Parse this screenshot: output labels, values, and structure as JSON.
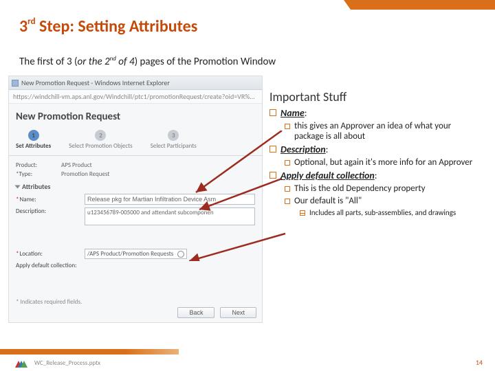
{
  "title": {
    "ord": "3",
    "ord_suffix": "rd",
    "rest": " Step:   Setting Attributes"
  },
  "subtitle": {
    "pre": "The first of 3 (",
    "italic_pre": "or the 2",
    "sup": "nd",
    "italic_post": " of 4",
    "post": ") pages of the Promotion Window"
  },
  "screenshot": {
    "window_title": "New Promotion Request - Windows Internet Explorer",
    "url": "https://windchill-vm.aps.anl.gov/Windchill/ptc1/promotionRequest/create?oid=VR%3...",
    "heading": "New Promotion Request",
    "steps": [
      {
        "num": "1",
        "label": "Set Attributes",
        "active": true
      },
      {
        "num": "2",
        "label": "Select Promotion Objects",
        "active": false
      },
      {
        "num": "3",
        "label": "Select Participants",
        "active": false
      }
    ],
    "product_lbl": "Product:",
    "product_val": "APS Product",
    "type_lbl": "*Type:",
    "type_val": "Promotion Request",
    "attributes_hdr": "Attributes",
    "name_lbl": "Name:",
    "name_val": "Release pkg for Martian Infiltration Device Asm",
    "desc_lbl": "Description:",
    "desc_val": "u123456789-005000 and attendant subcomponen",
    "loc_lbl": "Location:",
    "loc_val": "/APS Product/Promotion Requests",
    "apply_lbl": "Apply default collection:",
    "footnote": "* Indicates required fields.",
    "back_btn": "Back",
    "next_btn": "Next"
  },
  "right": {
    "heading": "Important Stuff",
    "name_label": "Name",
    "name_colon": ":",
    "name_desc": "this gives an Approver an idea of what your package is all about",
    "desc_label": "Description",
    "desc_colon": ":",
    "desc_desc": "Optional, but again it's more info for an Approver",
    "apply_label": "Apply default collection",
    "apply_colon": ":",
    "apply_desc1": "This is the old Dependency property",
    "apply_desc2": "Our default is \"All\"",
    "apply_sub": "Includes all parts, sub-assemblies, and drawings"
  },
  "footer": {
    "filename": "WC_Release_Process.pptx",
    "page": "14"
  }
}
